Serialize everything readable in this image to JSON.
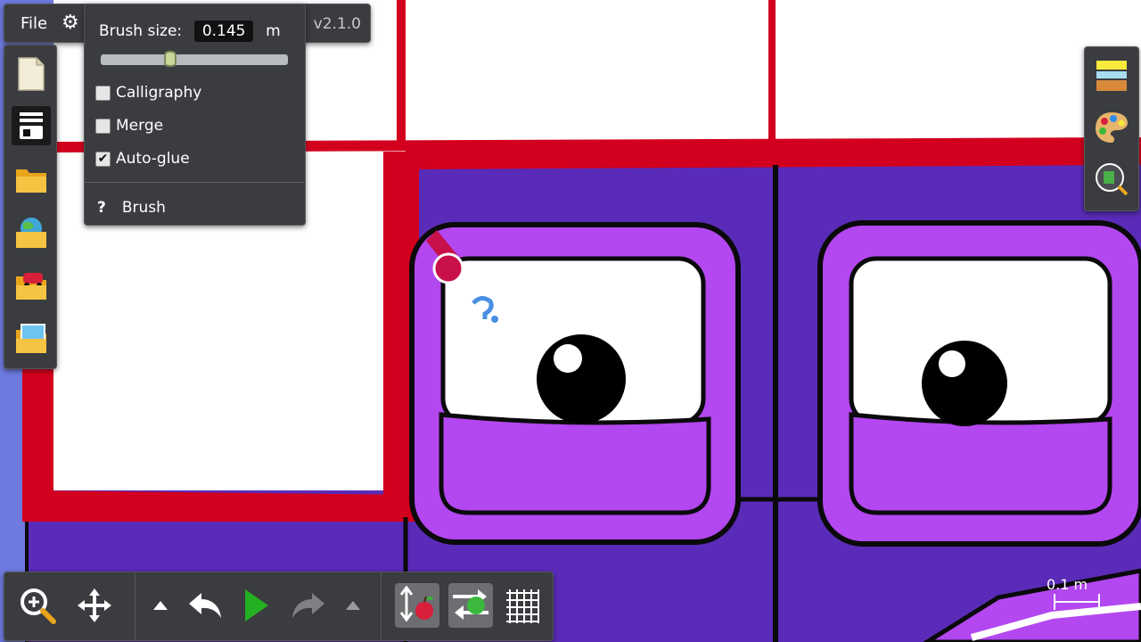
{
  "menu": {
    "file_label": "File",
    "version": "v2.1.0"
  },
  "brush_panel": {
    "size_label": "Brush size:",
    "size_value": "0.145",
    "size_unit": "m",
    "slider_fraction": 0.36,
    "options": [
      {
        "label": "Calligraphy",
        "checked": false
      },
      {
        "label": "Merge",
        "checked": false
      },
      {
        "label": "Auto-glue",
        "checked": true
      }
    ],
    "help_label": "Brush"
  },
  "scale": {
    "label": "0.1 m"
  },
  "colors": {
    "panel": "#3a3c40",
    "red_outline": "#d2001e",
    "purple": "#5a2bb8",
    "light_purple": "#b347f0"
  }
}
